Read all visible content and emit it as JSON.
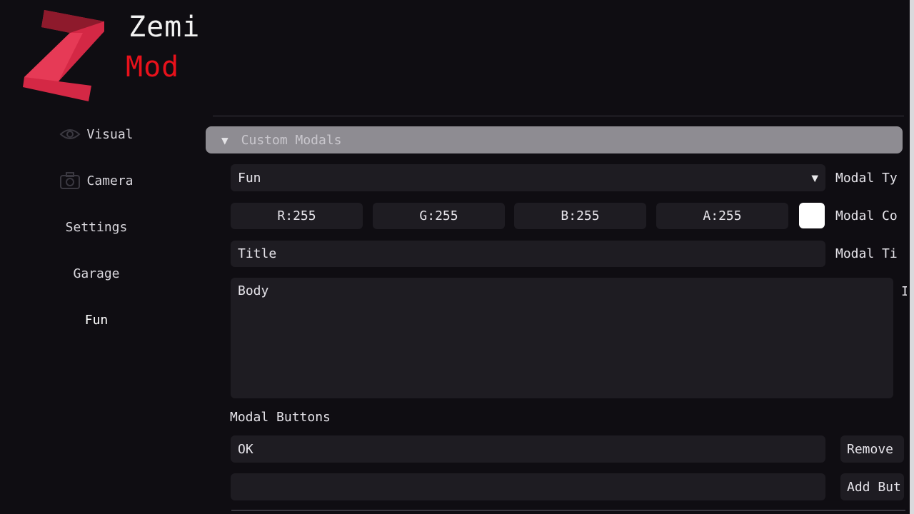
{
  "brand": {
    "logo_letter": "Z",
    "name": "Zemi",
    "sub": "Mod",
    "accent_color": "#e8111b"
  },
  "sidebar": {
    "items": [
      {
        "label": "Visual",
        "icon": "eye-icon"
      },
      {
        "label": "Camera",
        "icon": "camera-icon"
      },
      {
        "label": "Settings"
      },
      {
        "label": "Garage"
      },
      {
        "label": "Fun",
        "active": true
      }
    ]
  },
  "main": {
    "section": {
      "label": "Custom Modals",
      "expanded": true
    },
    "modal_type": {
      "value": "Fun",
      "label": "Modal Ty"
    },
    "modal_color": {
      "r": "R:255",
      "g": "G:255",
      "b": "B:255",
      "a": "A:255",
      "swatch": "#ffffff",
      "label": "Modal Co"
    },
    "modal_title": {
      "value": "Title",
      "label": "Modal Ti"
    },
    "modal_body": {
      "value": "Body",
      "label": "I"
    },
    "buttons_section": {
      "title": "Modal Buttons"
    },
    "button_entry": {
      "value": "OK",
      "remove_label": "Remove"
    },
    "new_button": {
      "value": "",
      "add_label": "Add But"
    }
  }
}
